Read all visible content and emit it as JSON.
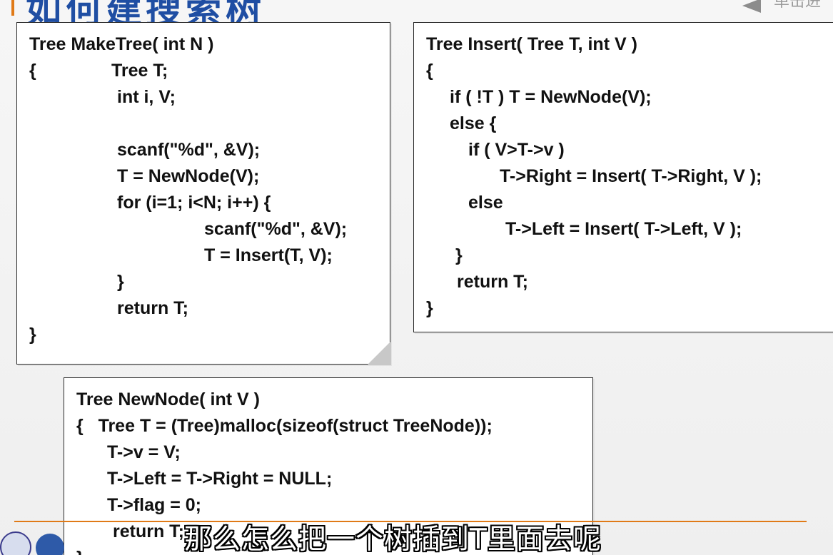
{
  "slide": {
    "title": "如何建搜索树",
    "nav_text": "单击进"
  },
  "maketree": {
    "lines": [
      "Tree MakeTree( int N )",
      "{",
      "Tree T;",
      "int i, V;",
      "scanf(\"%d\", &V);",
      "T = NewNode(V);",
      "for (i=1; i<N; i++) {",
      "scanf(\"%d\", &V);",
      "T = Insert(T, V);",
      "}",
      "return T;",
      "}"
    ]
  },
  "insert": {
    "lines": [
      "Tree Insert( Tree T, int V )",
      "{",
      "if ( !T ) T = NewNode(V);",
      "else {",
      "if ( V>T->v )",
      "T->Right = Insert( T->Right, V );",
      "else",
      "T->Left = Insert( T->Left, V );",
      "}",
      "return T;",
      "}"
    ]
  },
  "newnode": {
    "lines": [
      "Tree NewNode( int V )",
      "{   Tree T = (Tree)malloc(sizeof(struct TreeNode));",
      "T->v = V;",
      "T->Left = T->Right = NULL;",
      "T->flag = 0;",
      "return T;",
      "}"
    ]
  },
  "subtitle": "那么怎么把一个树插到T里面去呢"
}
